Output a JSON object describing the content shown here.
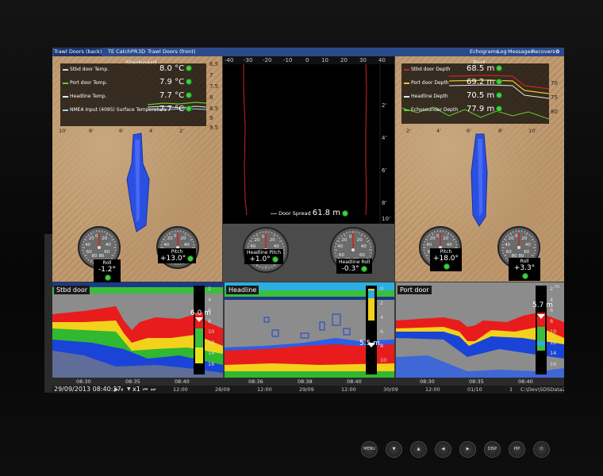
{
  "menu": {
    "tabs": [
      "Trawl Doors (back)",
      "TE CatchPR",
      "3D",
      "Trawl Doors (front)"
    ],
    "right": [
      "Echograms",
      "Log",
      "Messages",
      "Recovers"
    ]
  },
  "left_panel": {
    "title": "Starboard",
    "readouts": [
      {
        "label": "Stbd door Temp.",
        "value": "8.0 °C",
        "color": "#d8d8d8"
      },
      {
        "label": "Port door Temp.",
        "value": "7.9 °C",
        "color": "#66cc33"
      },
      {
        "label": "Headline Temp.",
        "value": "7.7 °C",
        "color": "#e8e8e8"
      },
      {
        "label": "NMEA Input (4095) Surface Temperature",
        "value": "7.7 °C",
        "color": "#a0d0f0"
      }
    ],
    "right_scale": [
      "6.5",
      "7",
      "7.5",
      "8",
      "8.5",
      "9",
      "9.5"
    ],
    "bottom_scale": [
      "10'",
      "8'",
      "6'",
      "4'",
      "2'"
    ],
    "roll": {
      "label": "Roll",
      "value": "-1.2°"
    },
    "pitch": {
      "label": "Pitch",
      "value": "+13.0°"
    }
  },
  "right_panel": {
    "title": "Port",
    "readouts": [
      {
        "label": "Stbd door Depth",
        "value": "68.5 m",
        "color": "#cc2222"
      },
      {
        "label": "Port door Depth",
        "value": "69.2 m",
        "color": "#e6c82a"
      },
      {
        "label": "Headline Depth",
        "value": "70.5 m",
        "color": "#e8e8e8"
      },
      {
        "label": "Echosounder Depth",
        "value": "77.9 m",
        "color": "#66cc33"
      }
    ],
    "right_scale": [
      "70",
      "75",
      "80"
    ],
    "bottom_scale": [
      "2'",
      "4'",
      "6'",
      "8'",
      "10'"
    ],
    "pitch": {
      "label": "Pitch",
      "value": "+18.0°"
    },
    "roll": {
      "label": "Roll",
      "value": "+3.3°"
    }
  },
  "center": {
    "top_ticks": [
      "-40",
      "-30",
      "-20",
      "-10",
      "0",
      "10",
      "20",
      "30",
      "40"
    ],
    "y_ticks": [
      "2'",
      "4'",
      "6'",
      "8'",
      "10'"
    ],
    "door_spread": {
      "label": "Door Spread",
      "value": "61.8 m"
    },
    "headline_pitch": {
      "label": "Headline Pitch",
      "value": "+1.0°"
    },
    "headline_roll": {
      "label": "Headline Roll",
      "value": "-0.3°"
    }
  },
  "gauge_ticks": [
    "80",
    "60",
    "40",
    "20",
    "0",
    "20",
    "40",
    "60",
    "80"
  ],
  "echograms": [
    {
      "title": "Stbd door",
      "depth": "6.0 m",
      "scale": [
        "2",
        "4",
        "6",
        "8",
        "10",
        "12",
        "14",
        "16"
      ],
      "times": [
        "08:30",
        "08:35",
        "08:40"
      ]
    },
    {
      "title": "Headline",
      "depth": "5.5 m",
      "scale": [
        "0",
        "2",
        "4",
        "6",
        "8",
        "10"
      ],
      "times": [
        "08:36",
        "08:38",
        "08:40"
      ]
    },
    {
      "title": "Port door",
      "depth": "5.7 m",
      "scale": [
        "2",
        "4",
        "6",
        "8",
        "10",
        "12",
        "14",
        "16"
      ],
      "times": [
        "08:30",
        "08:35",
        "08:40"
      ],
      "unit": "m"
    }
  ],
  "status": {
    "datetime": "29/09/2013 08:40:27",
    "speed": "x1",
    "timeline": [
      "12:00",
      "28/09",
      "12:00",
      "29/09",
      "12:00",
      "30/09",
      "12:00",
      "01/10",
      "1"
    ],
    "path": "C:\\Dev\\SDSData2"
  },
  "hardware_buttons": [
    "MENU",
    "▼",
    "▲",
    "◀",
    "▶",
    "DISP",
    "PIP",
    "⏻"
  ],
  "colors": {
    "menu": "#2a4a8a",
    "green_dot": "#3fcf3f",
    "trawl_blue": "#2b4fe0",
    "spread_line": "#cc2222"
  }
}
